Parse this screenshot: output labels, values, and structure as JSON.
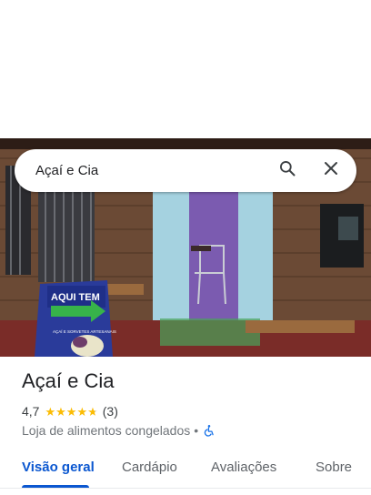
{
  "search": {
    "query": "Açaí e Cia",
    "search_icon": "search-icon",
    "clear_icon": "close-icon"
  },
  "hero": {
    "sign_line1": "AQUI TEM",
    "sign_line2": "AÇAÍ E SORVETES ARTESANAIS"
  },
  "place": {
    "name": "Açaí e Cia",
    "rating": "4,7",
    "stars_value": 4.7,
    "review_count": "(3)",
    "category": "Loja de alimentos congelados",
    "separator": "•",
    "accessibility_icon": "wheelchair-icon"
  },
  "tabs": [
    {
      "label": "Visão geral",
      "active": true
    },
    {
      "label": "Cardápio",
      "active": false
    },
    {
      "label": "Avaliações",
      "active": false
    },
    {
      "label": "Sobre",
      "active": false
    }
  ],
  "colors": {
    "accent": "#0b57d0",
    "star": "#fbbc04"
  }
}
